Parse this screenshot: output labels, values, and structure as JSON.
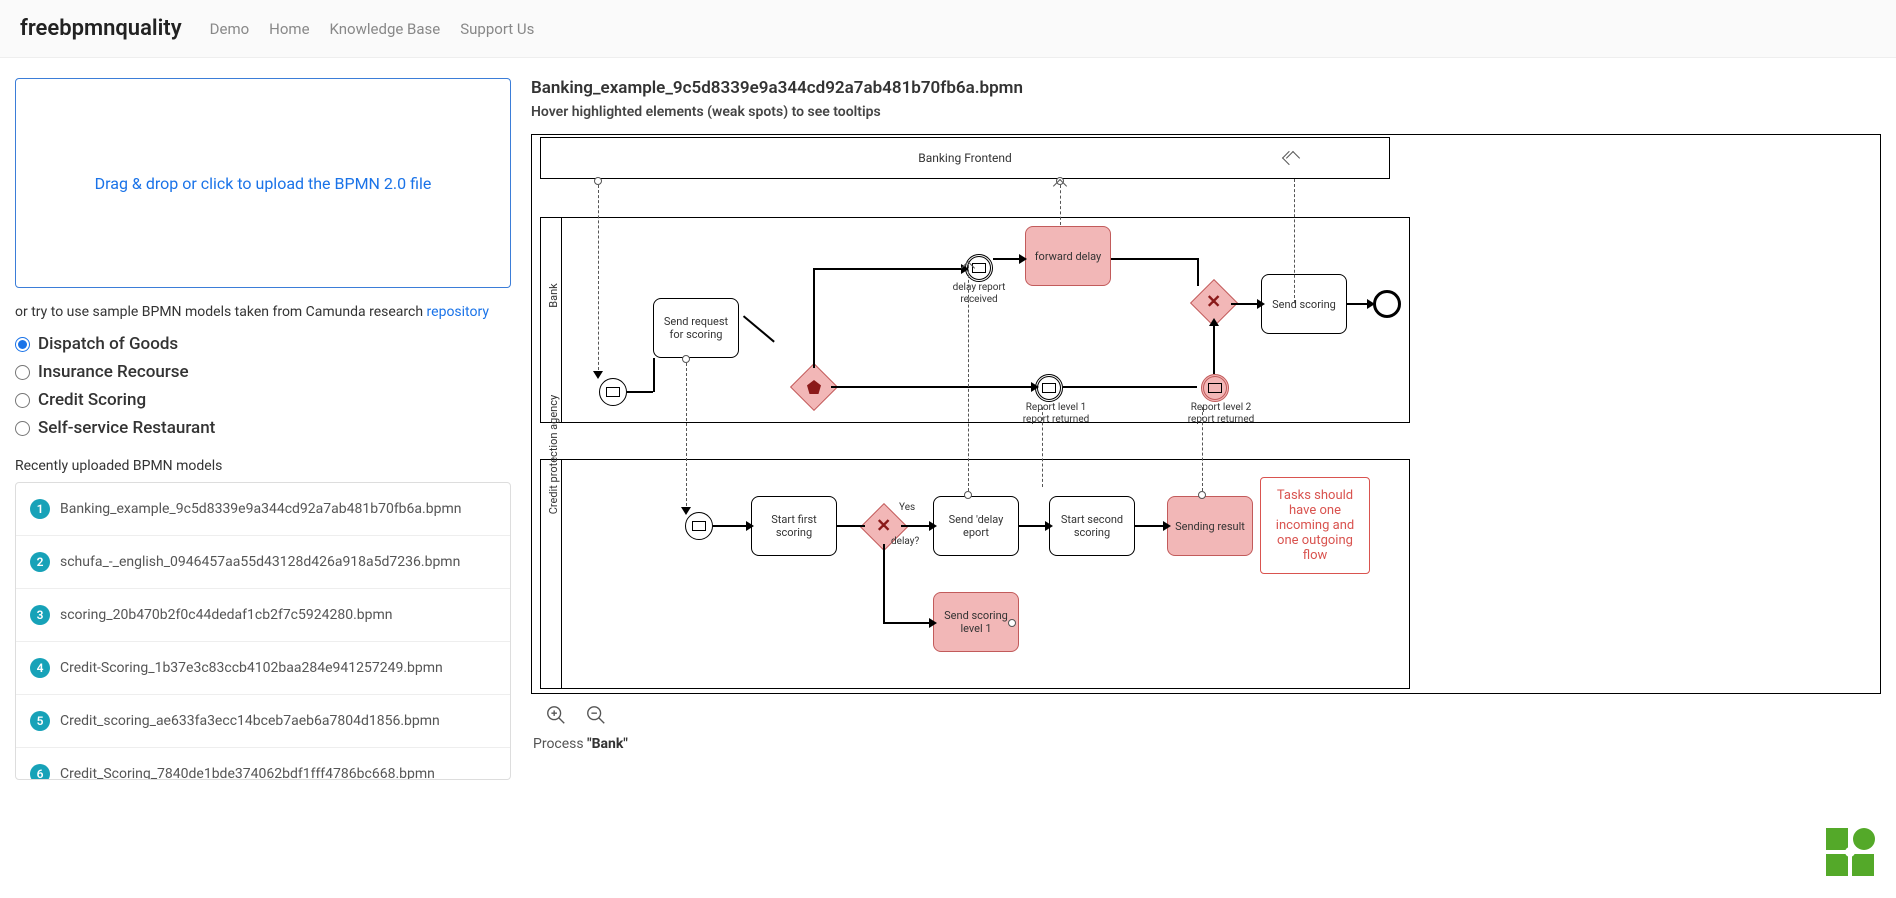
{
  "nav": {
    "brand": "freebpmnquality",
    "links": [
      "Demo",
      "Home",
      "Knowledge Base",
      "Support Us"
    ]
  },
  "upload": {
    "text": "Drag & drop or click to upload the BPMN 2.0 file"
  },
  "sample_line": {
    "prefix": "or try to use sample BPMN models taken from Camunda research ",
    "link": "repository"
  },
  "samples": [
    {
      "label": "Dispatch of Goods",
      "selected": true
    },
    {
      "label": "Insurance Recourse",
      "selected": false
    },
    {
      "label": "Credit Scoring",
      "selected": false
    },
    {
      "label": "Self-service Restaurant",
      "selected": false
    }
  ],
  "recent": {
    "heading": "Recently uploaded BPMN models",
    "items": [
      "Banking_example_9c5d8339e9a344cd92a7ab481b70fb6a.bpmn",
      "schufa_-_english_0946457aa55d43128d426a918a5d7236.bpmn",
      "scoring_20b470b2f0c44dedaf1cb2f7c5924280.bpmn",
      "Credit-Scoring_1b37e3c83ccb4102baa284e941257249.bpmn",
      "Credit_scoring_ae633fa3ecc14bceb7aeb6a7804d1856.bpmn",
      "Credit_Scoring_7840de1bde374062bdf1fff4786bc668.bpmn"
    ]
  },
  "file": {
    "title": "Banking_example_9c5d8339e9a344cd92a7ab481b70fb6a.bpmn",
    "subtitle": "Hover highlighted elements (weak spots) to see tooltips"
  },
  "diagram": {
    "pool_top": "Banking Frontend",
    "pool_mid": "Bank",
    "pool_bot": "Credit protection agency",
    "tasks": {
      "send_request": "Send request for scoring",
      "forward_delay": "forward delay",
      "send_scoring": "Send scoring",
      "start_first": "Start first scoring",
      "send_delay_report": "Send 'delay eport",
      "start_second": "Start second scoring",
      "sending_result": "Sending result",
      "send_scoring_l1": "Send scoring level 1"
    },
    "labels": {
      "delay_received": "delay report received",
      "report_l1": "Report level 1 report returned",
      "report_l2": "Report level 2 report returned",
      "yes": "Yes",
      "delay_q": "delay?"
    },
    "tooltip": "Tasks should have one incoming and one outgoing flow"
  },
  "process_footer": {
    "prefix": "Process ",
    "name": "\"Bank\""
  }
}
